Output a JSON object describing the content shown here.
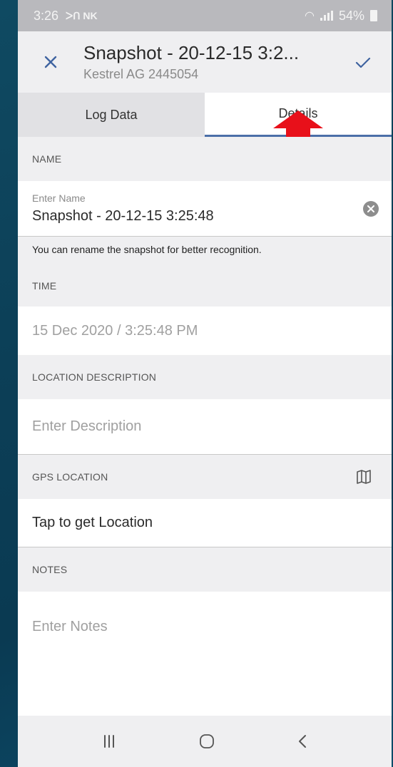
{
  "status_bar": {
    "time": "3:26",
    "carrier_icons": "ᐳᑎ NK",
    "battery": "54%"
  },
  "header": {
    "title": "Snapshot - 20-12-15 3:2...",
    "subtitle": "Kestrel AG 2445054"
  },
  "tabs": [
    {
      "label": "Log Data"
    },
    {
      "label": "Details",
      "active": true
    }
  ],
  "annotation": {
    "arrow_color": "#e8101a"
  },
  "name_section": {
    "header": "NAME",
    "field_label": "Enter Name",
    "value": "Snapshot - 20-12-15 3:25:48",
    "hint": "You can rename the snapshot for better recognition."
  },
  "time_section": {
    "header": "TIME",
    "value": "15 Dec 2020 / 3:25:48 PM"
  },
  "location_description": {
    "header": "LOCATION DESCRIPTION",
    "placeholder": "Enter Description"
  },
  "gps_location": {
    "header": "GPS LOCATION",
    "action": "Tap to get Location"
  },
  "notes": {
    "header": "NOTES",
    "placeholder": "Enter Notes"
  },
  "colors": {
    "accent": "#4b6fa8",
    "section_bg": "#efeff1",
    "arrow": "#e8101a"
  }
}
